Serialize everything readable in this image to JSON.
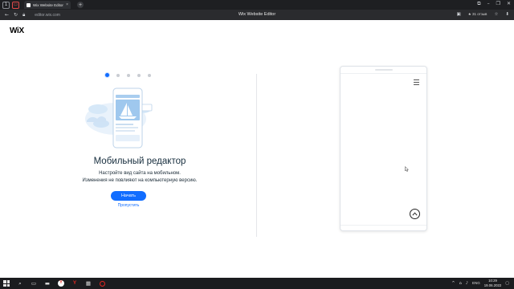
{
  "browser": {
    "tab_title": "Wix Website Editor",
    "new_tab_symbol": "+",
    "url": "editor.wix.com",
    "page_heading": "Wix Website Editor",
    "reviews_label": "★ 31 отзыв",
    "tab_close_symbol": "×"
  },
  "editor": {
    "logo": "WiX",
    "onboarding": {
      "total_steps": 5,
      "active_step": 1,
      "title": "Мобильный редактор",
      "subtitle_line1": "Настройте вид сайта на мобильном.",
      "subtitle_line2": "Изменения не повлияют на компьютерную версию.",
      "start_button": "Начать",
      "skip_link": "Пропустить"
    }
  },
  "taskbar": {
    "yandex_label": "Y",
    "red_app_label": "Y",
    "lang": "ENG",
    "time": "10:29",
    "date": "19.06.2022"
  },
  "colors": {
    "accent": "#116dff",
    "title_text": "#162d3d"
  },
  "icons": [
    "back-arrow-icon",
    "forward-icon",
    "reload-icon",
    "bookmark-icon",
    "download-icon",
    "extensions-icon",
    "menu-icon",
    "hamburger-icon",
    "scroll-to-top-icon",
    "search-icon",
    "windows-start-icon"
  ]
}
